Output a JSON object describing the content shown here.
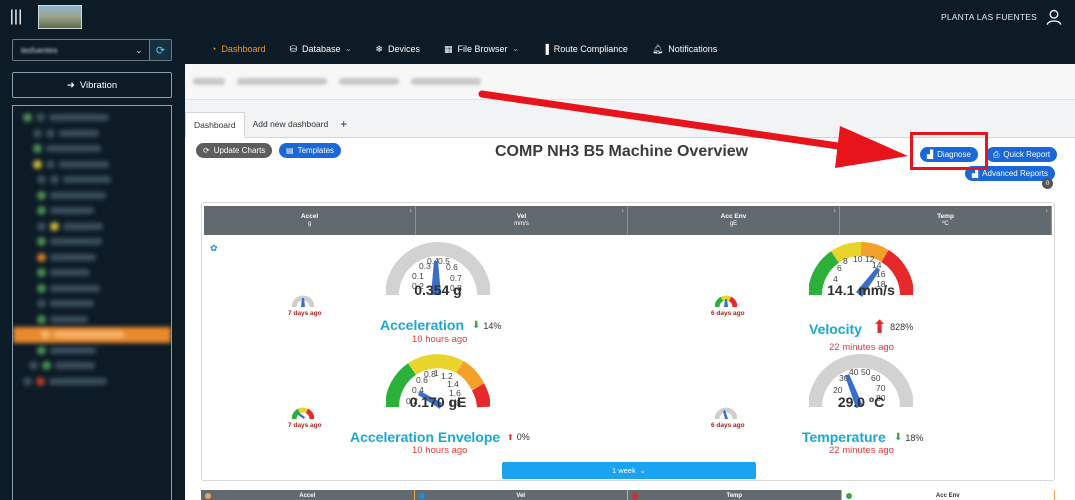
{
  "topbar": {
    "org_name": "PLANTA LAS FUENTES"
  },
  "nav": {
    "items": [
      {
        "label": "Dashboard",
        "icon": "dashboard-icon"
      },
      {
        "label": "Database",
        "icon": "database-icon"
      },
      {
        "label": "Devices",
        "icon": "devices-icon"
      },
      {
        "label": "File Browser",
        "icon": "file-browser-icon"
      },
      {
        "label": "Route Compliance",
        "icon": "chart-icon"
      },
      {
        "label": "Notifications",
        "icon": "bell-icon"
      }
    ],
    "active": "Dashboard"
  },
  "sidebar": {
    "site_value": "lasfuentes",
    "vibration_label": "Vibration"
  },
  "tabs": {
    "dashboard": "Dashboard",
    "add_new": "Add new dashboard",
    "plus": "+"
  },
  "toolbar": {
    "update_charts": "Update Charts",
    "templates": "Templates",
    "diagnose": "Diagnose",
    "quick_report": "Quick Report",
    "advanced_reports": "Advanced Reports",
    "badge_count": "0"
  },
  "page_title": "COMP NH3 B5 Machine Overview",
  "grid_headers": [
    {
      "name": "Accel",
      "unit": "g"
    },
    {
      "name": "Vel",
      "unit": "mm/s"
    },
    {
      "name": "Acc Env",
      "unit": "gE"
    },
    {
      "name": "Temp",
      "unit": "ºC"
    }
  ],
  "gauges": {
    "acceleration": {
      "value": "0.354 g",
      "name": "Acceleration",
      "pct": "14%",
      "trend": "down",
      "time": "10 hours ago",
      "ticks": [
        "0.1",
        "0.2",
        "0.3",
        "0.4",
        "0.5",
        "0.6",
        "0.7",
        "0.8"
      ]
    },
    "velocity": {
      "value": "14.1 mm/s",
      "name": "Velocity",
      "pct": "828%",
      "trend": "up",
      "time": "22 minutes ago",
      "ticks": [
        "4",
        "6",
        "8",
        "10",
        "12",
        "14",
        "16",
        "18"
      ]
    },
    "envelope": {
      "value": "0.170 gE",
      "name": "Acceleration Envelope",
      "pct": "0%",
      "trend": "up-small",
      "time": "10 hours ago",
      "ticks": [
        "0.2",
        "0.4",
        "0.6",
        "0.8",
        "1",
        "1.2",
        "1.4",
        "1.6",
        "1.8"
      ]
    },
    "temperature": {
      "value": "29.0 ºC",
      "name": "Temperature",
      "pct": "18%",
      "trend": "down",
      "time": "22 minutes ago",
      "ticks": [
        "20",
        "30",
        "40",
        "50",
        "60",
        "70",
        "80"
      ]
    }
  },
  "mini_labels": {
    "accel": "7 days ago",
    "vel": "6 days ago",
    "env": "7 days ago",
    "temp": "6 days ago"
  },
  "range_button": "1 week",
  "bottom_headers": [
    "Accel",
    "Vel",
    "Temp",
    "Acc Env"
  ],
  "colors": {
    "accent_orange": "#f39a1b",
    "nav_bg": "#0d1b26",
    "gauge_title": "#1ba7d4",
    "time_red": "#e23b3b",
    "primary_blue": "#1a67d8",
    "highlight_red": "#e8141c"
  }
}
